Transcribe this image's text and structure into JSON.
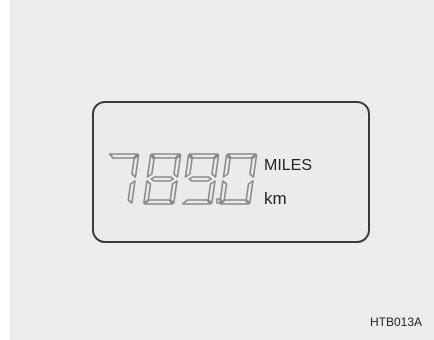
{
  "odometer": {
    "digits": [
      "7",
      "8",
      "9",
      "0"
    ],
    "unit_primary": "MILES",
    "unit_secondary": "km"
  },
  "figure_code": "HTB013A",
  "colors": {
    "panel_background": "#ececec",
    "display_border": "#3a3a3a",
    "segment_outline": "#8a8a8a",
    "text": "#222222"
  }
}
